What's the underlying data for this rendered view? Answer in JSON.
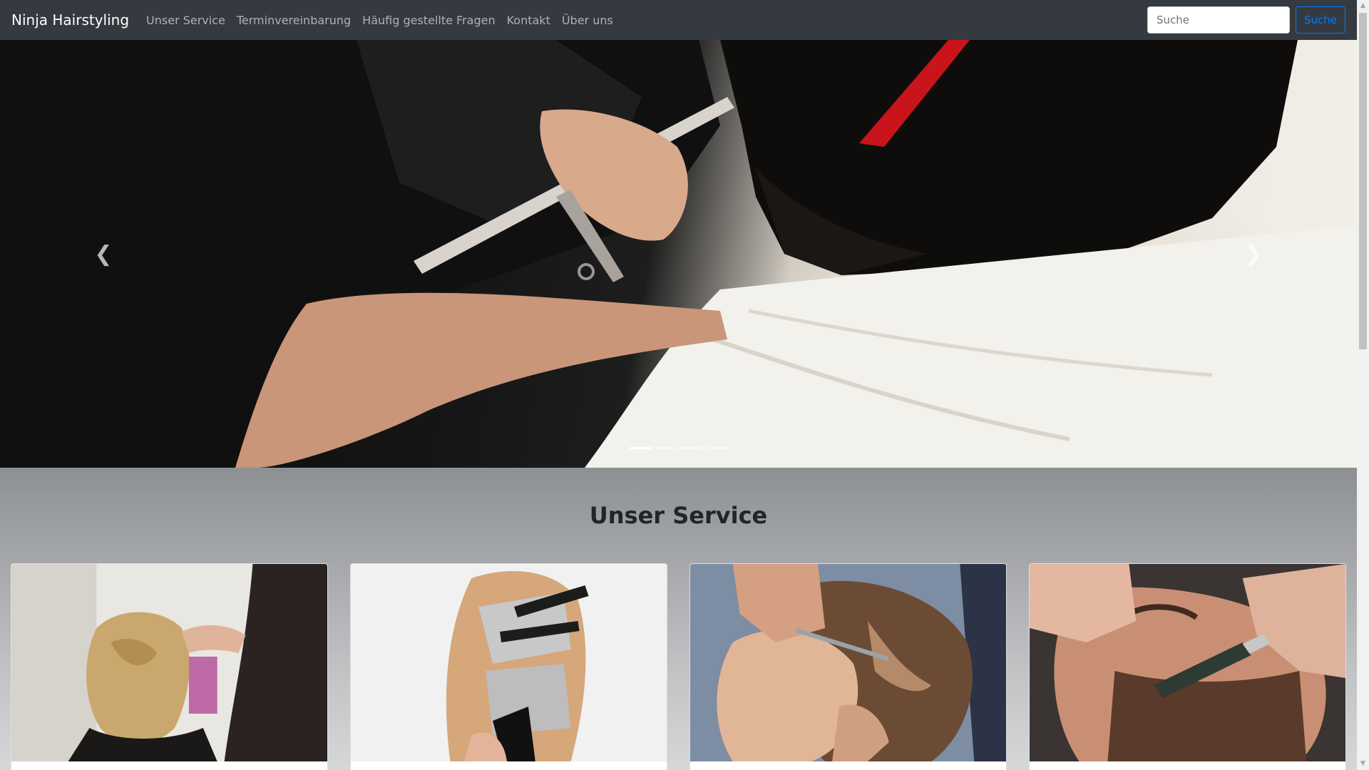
{
  "navbar": {
    "brand": "Ninja Hairstyling",
    "links": [
      "Unser Service",
      "Terminvereinbarung",
      "Häufig gestellte Fragen",
      "Kontakt",
      "Über uns"
    ],
    "search_placeholder": "Suche",
    "search_button": "Suche"
  },
  "carousel": {
    "prev_icon": "chevron-left-icon",
    "next_icon": "chevron-right-icon",
    "slide_count": 4,
    "active_slide": 1,
    "slide_image": "hairdresser-cutting-hair-with-comb-and-scissors"
  },
  "services": {
    "title": "Unser Service",
    "cards": [
      {
        "image": "updo-hairstyling"
      },
      {
        "image": "hair-coloring-with-foils"
      },
      {
        "image": "boy-haircut-with-pattern"
      },
      {
        "image": "beard-shave-with-razor"
      }
    ]
  },
  "colors": {
    "navbar_bg": "#343a40",
    "primary": "#007bff",
    "section_bg": "#a4a6a9"
  }
}
